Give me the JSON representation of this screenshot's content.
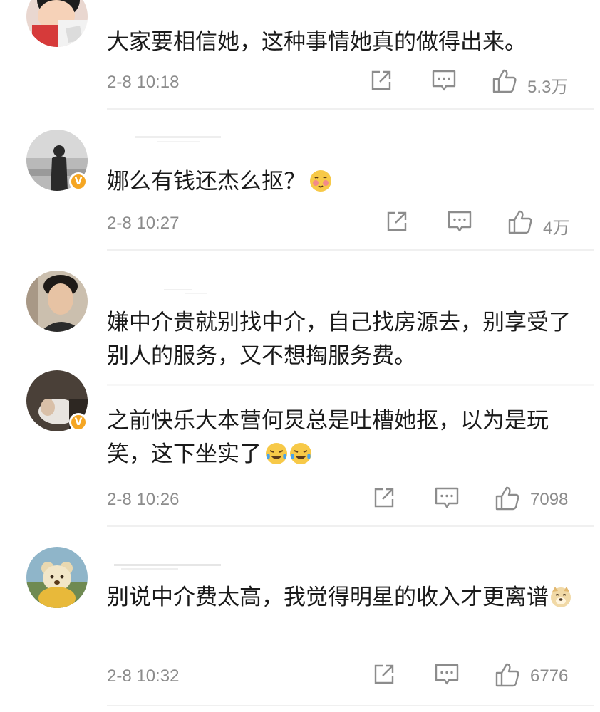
{
  "comments": [
    {
      "text": "大家要相信她，这种事情她真的做得出来。",
      "time": "2-8 10:18",
      "likes": "5.3万",
      "verified": false
    },
    {
      "text": "娜么有钱还杰么抠？",
      "time": "2-8 10:27",
      "likes": "4万",
      "verified": true
    },
    {
      "text": "嫌中介贵就别找中介，自己找房源去，别享受了别人的服务，又不想掏服务费。",
      "verified": false
    },
    {
      "text": "之前快乐大本营何炅总是吐槽她抠，以为是玩笑，这下坐实了",
      "time": "2-8 10:26",
      "likes": "7098",
      "verified": true
    },
    {
      "text": "别说中介费太高，我觉得明星的收入才更离谱",
      "time": "2-8 10:32",
      "likes": "6776",
      "verified": false
    }
  ],
  "icons": {
    "share": "share-icon",
    "comment": "comment-icon",
    "like": "like-icon",
    "verified": "verified-icon"
  },
  "colors": {
    "text": "#1a1a1a",
    "meta": "#8c8c8c",
    "badge": "#f5a623",
    "divider": "#f0f0f0"
  }
}
